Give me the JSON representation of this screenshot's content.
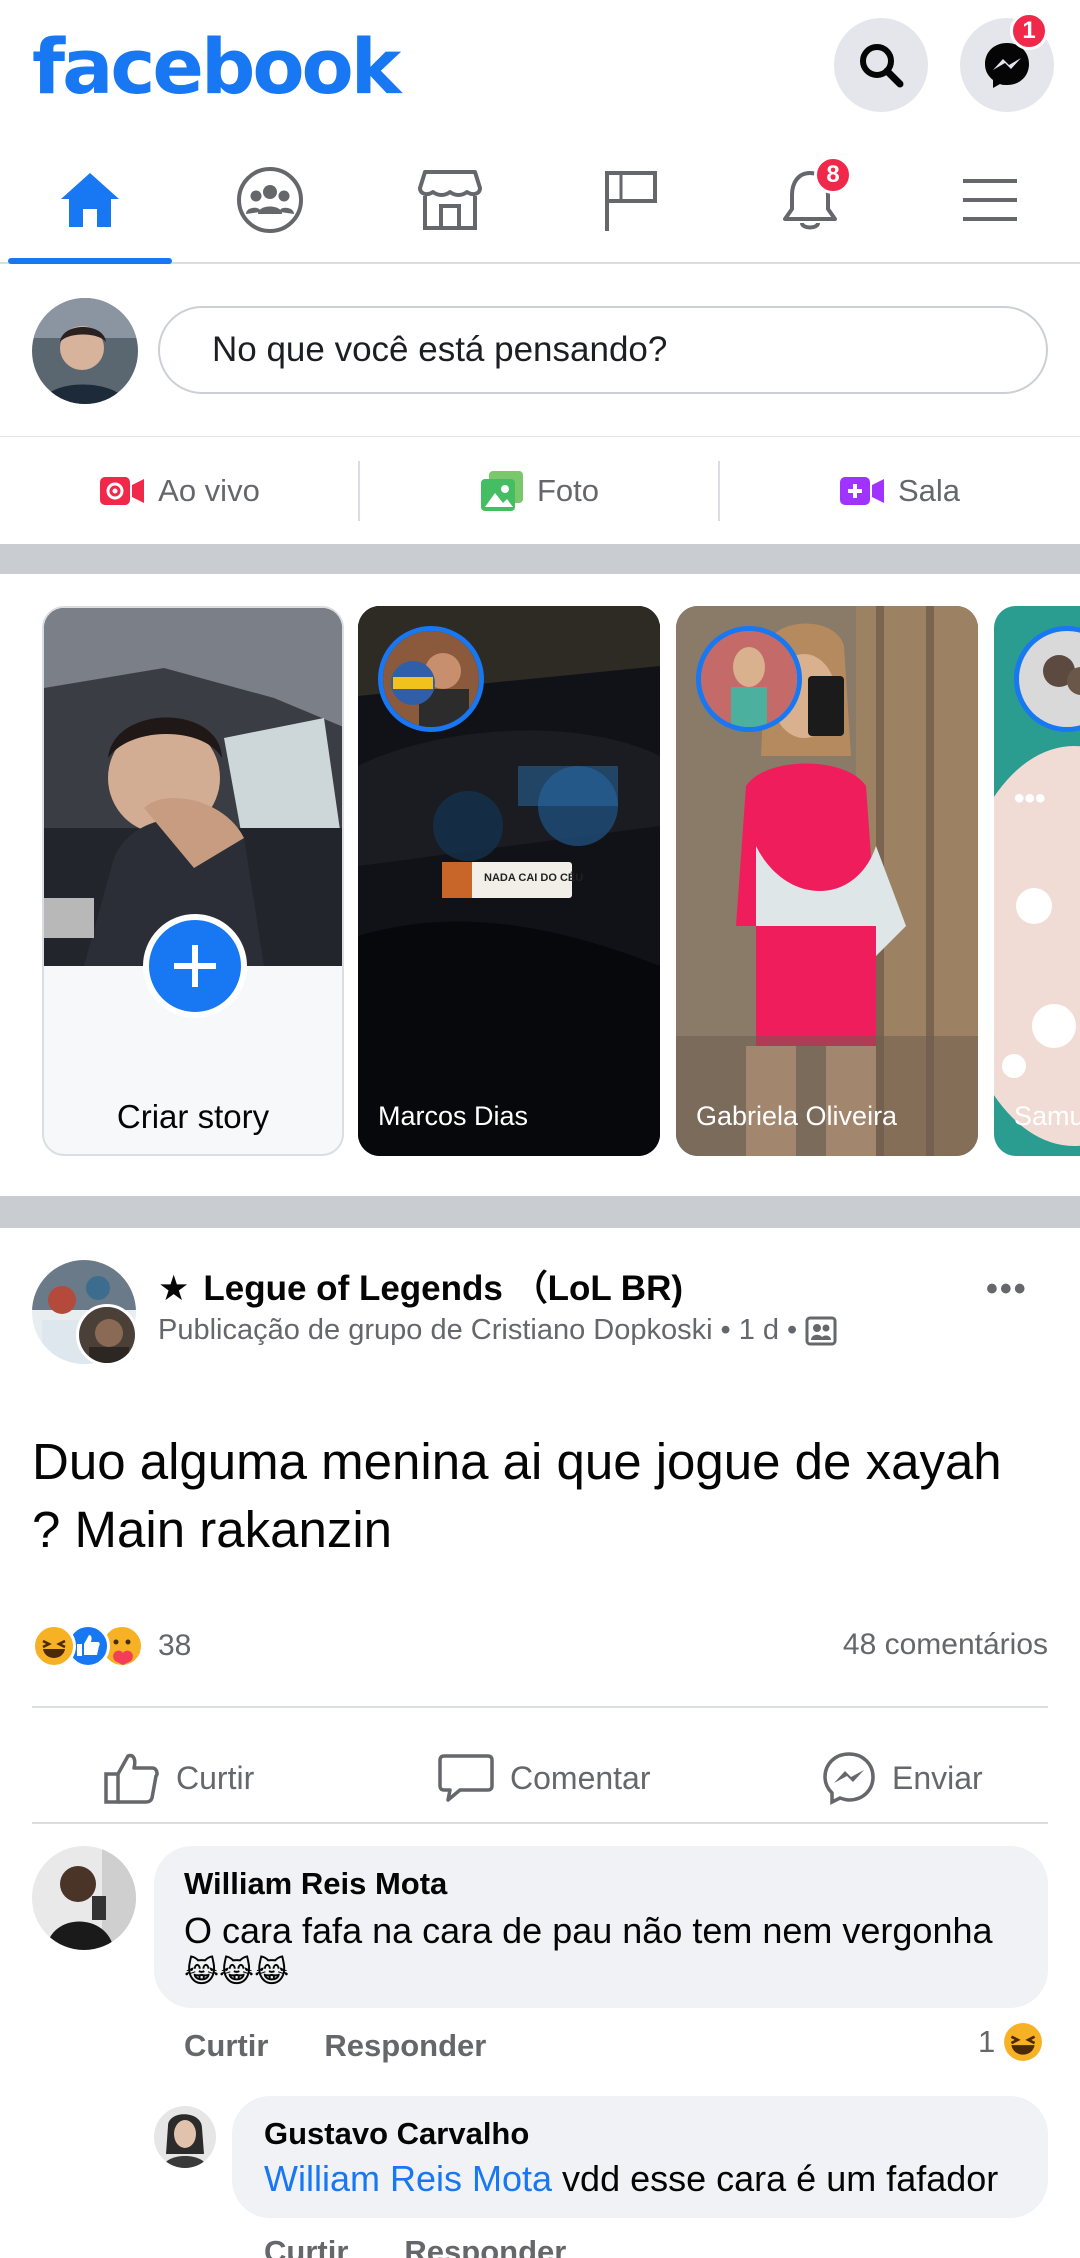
{
  "header": {
    "logo": "facebook",
    "messenger_badge": "1"
  },
  "nav": {
    "notifications_badge": "8"
  },
  "composer": {
    "placeholder": "No que você está pensando?"
  },
  "actions": {
    "live": "Ao vivo",
    "photo": "Foto",
    "room": "Sala"
  },
  "stories": {
    "create_label": "Criar story",
    "items": [
      {
        "name": "Marcos Dias",
        "sticker": "NADA CAI DO CÉU"
      },
      {
        "name": "Gabriela Oliveira"
      },
      {
        "name": "Samu"
      }
    ]
  },
  "post": {
    "group_name": "Legue of Legends （LoL BR)",
    "subtitle": "Publicação de grupo de Cristiano Dopkoski",
    "time": "1 d",
    "text": "Duo alguma menina ai que jogue de xayah ? Main rakanzin",
    "reactions_count": "38",
    "comments_count": "48 comentários",
    "like": "Curtir",
    "comment": "Comentar",
    "send": "Enviar"
  },
  "comments": [
    {
      "author": "William Reis Mota",
      "text": "O cara fafa na cara de pau não tem nem vergonha",
      "emoji": "😹😹😹",
      "like": "Curtir",
      "reply": "Responder",
      "reaction_count": "1"
    },
    {
      "author": "Gustavo Carvalho",
      "mention": "William Reis Mota",
      "text": " vdd esse cara é um fafador",
      "like": "Curtir",
      "reply": "Responder"
    }
  ],
  "colors": {
    "brand": "#1877f2",
    "badge": "#f02849",
    "bubble": "#f0f2f5"
  }
}
